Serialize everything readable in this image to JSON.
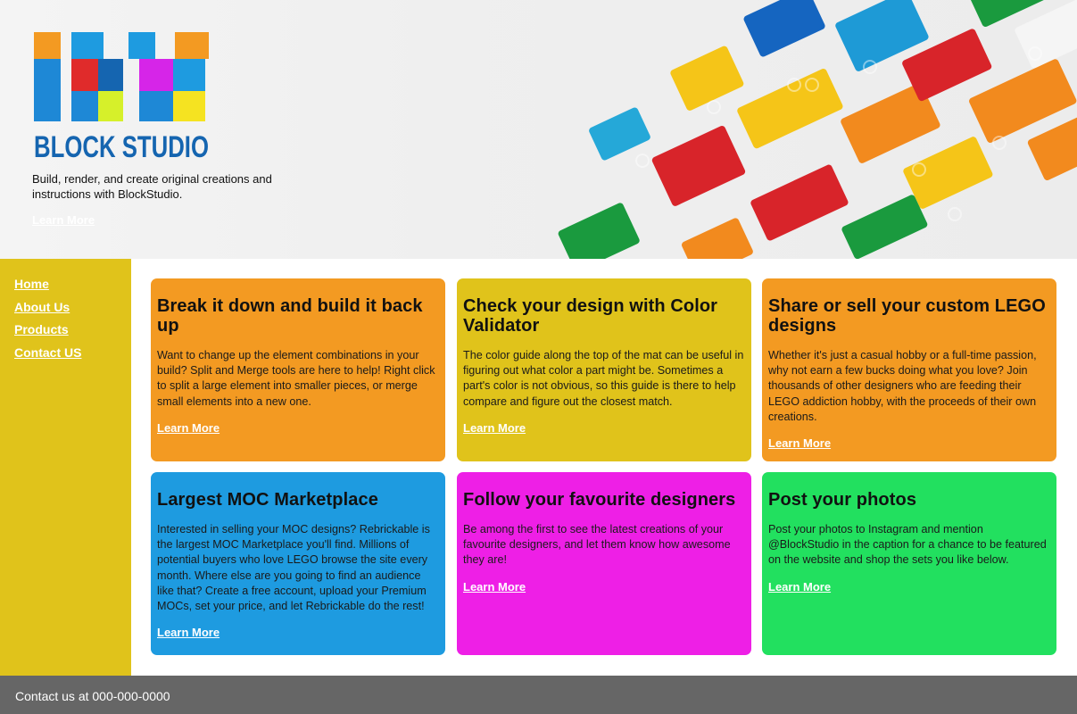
{
  "brand": {
    "name": "BLOCK STUDIO",
    "tagline": "Build, render, and create original creations and instructions with BlockStudio.",
    "hero_link": "Learn More"
  },
  "nav": {
    "items": [
      {
        "label": "Home"
      },
      {
        "label": "About Us"
      },
      {
        "label": "Products"
      },
      {
        "label": "Contact US"
      }
    ]
  },
  "cards": [
    {
      "title": "Break it down and build it back up",
      "body": "Want to change up the element combinations in your build? Split and Merge tools are here to help! Right click to split a large element into smaller pieces, or merge small elements into a new one.",
      "link": "Learn More",
      "color": "#f39a22"
    },
    {
      "title": "Check your design with Color Validator",
      "body": "The color guide along the top of the mat can be useful in figuring out what color a part might be. Sometimes a part's color is not obvious, so this guide is there to help compare and figure out the closest match.",
      "link": "Learn More",
      "color": "#e0c31b"
    },
    {
      "title": "Share or sell your custom LEGO designs",
      "body": "Whether it's just a casual hobby or a full-time passion, why not earn a few bucks doing what you love? Join thousands of other designers who are feeding their LEGO addiction hobby, with the proceeds of their own creations.",
      "link": "Learn More",
      "color": "#f39a22"
    },
    {
      "title": "Largest MOC Marketplace",
      "body": "Interested in selling your MOC designs? Rebrickable is the largest MOC Marketplace you'll find. Millions of potential buyers who love LEGO browse the site every month. Where else are you going to find an audience like that? Create a free account, upload your Premium MOCs, set your price, and let Rebrickable do the rest!",
      "link": "Learn More",
      "color": "#1e9be0"
    },
    {
      "title": "Follow your favourite designers",
      "body": "Be among the first to see the latest creations of your favourite designers, and let them know how awesome they are!",
      "link": "Learn More",
      "color": "#ee1fe6"
    },
    {
      "title": "Post your photos",
      "body": "Post your photos to Instagram and mention @BlockStudio in the caption for a chance to be featured on the website and shop the sets you like below.",
      "link": "Learn More",
      "color": "#22e05f"
    }
  ],
  "footer": {
    "text": "Contact us at 000-000-0000"
  },
  "colors": {
    "sidebar": "#e0c31b",
    "footer": "#666666",
    "brand_blue": "#1565b0"
  }
}
